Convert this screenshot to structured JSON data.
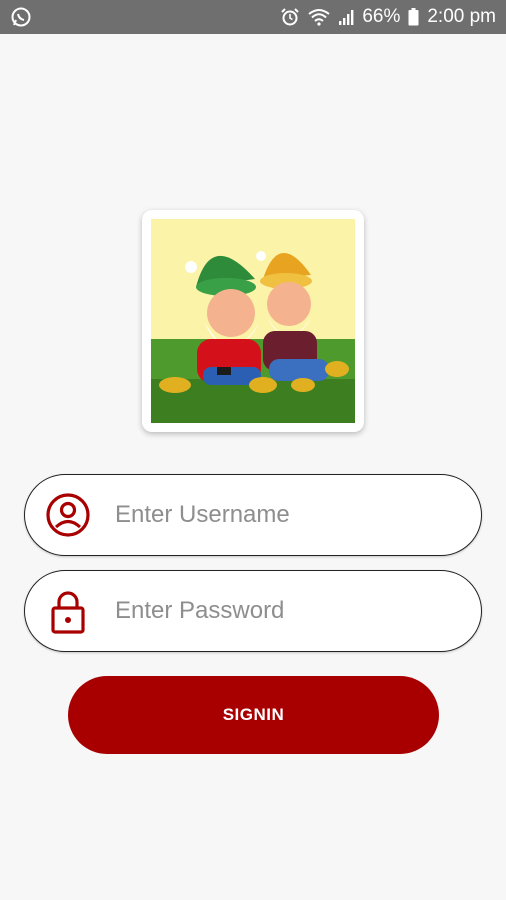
{
  "status_bar": {
    "battery_percent": "66%",
    "time": "2:00 pm",
    "icons": [
      "whatsapp-icon",
      "alarm-icon",
      "wifi-icon",
      "signal-icon",
      "battery-icon"
    ]
  },
  "logo": {
    "icon": "dwarves-logo-image"
  },
  "form": {
    "username_placeholder": "Enter Username",
    "password_placeholder": "Enter Password",
    "signin_label": "SIGNIN"
  },
  "colors": {
    "accent": "#a80000",
    "background": "#f7f7f7",
    "status_bar": "#6f6f6f"
  }
}
